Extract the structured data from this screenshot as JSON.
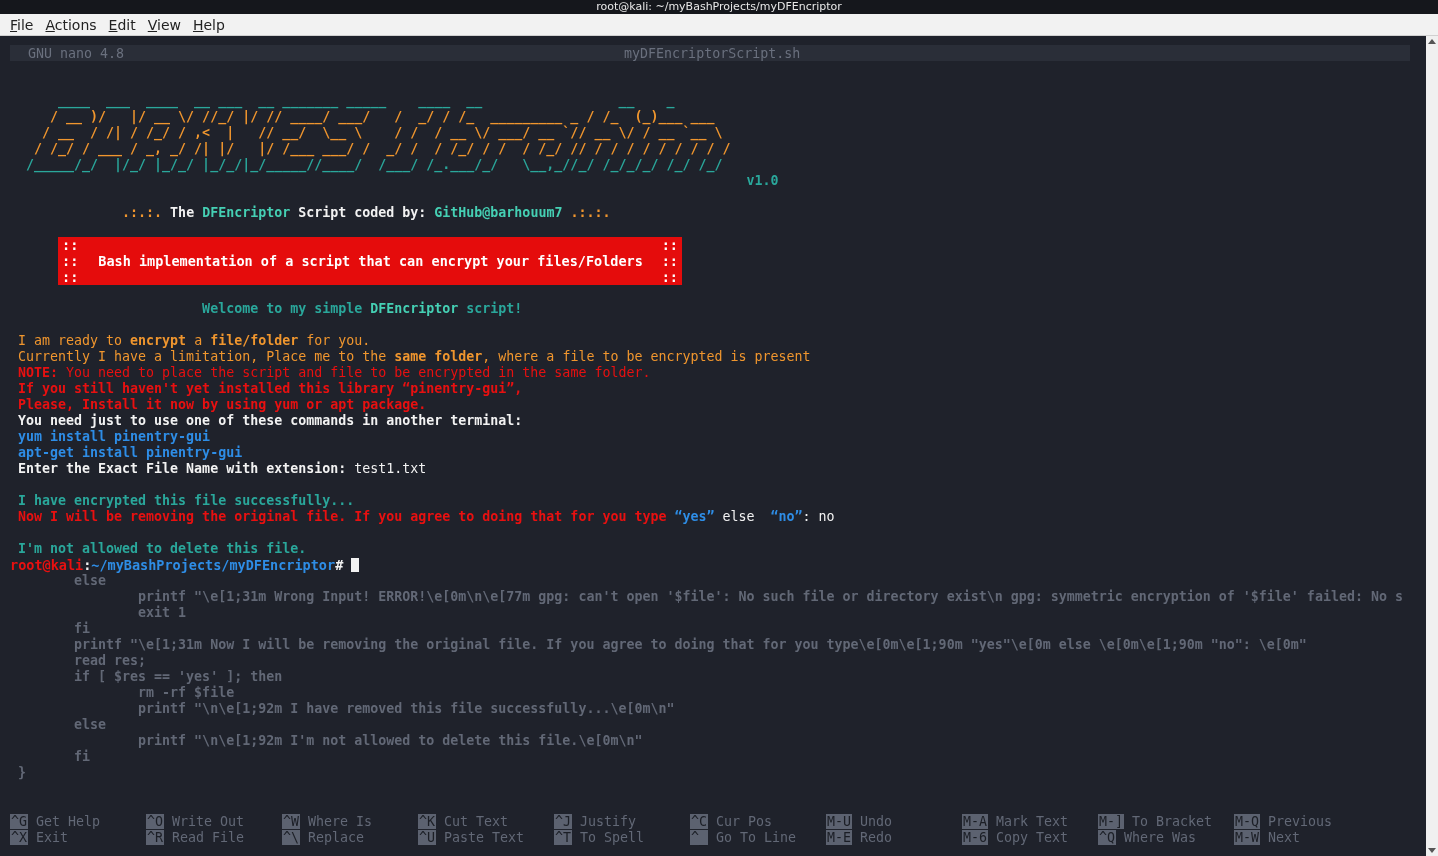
{
  "window": {
    "title": "root@kali: ~/myBashProjects/myDFEncriptor"
  },
  "menu": [
    {
      "label": "File"
    },
    {
      "label": "Actions"
    },
    {
      "label": "Edit"
    },
    {
      "label": "View"
    },
    {
      "label": "Help"
    }
  ],
  "editor_header": {
    "version": "GNU nano 4.8",
    "file": "myDFEncriptorScript.sh"
  },
  "terminal_lines": [
    {
      "kind": "art",
      "text": "     ____  ___  ____  __ ___  __ _______ _____    ____  __                 __    _        "
    },
    {
      "kind": "art",
      "text": "    / __ )/   |/ __ \\/ //_/ |/ // ____/ ___/   /  _/ / /_  _________ _ / /_  (_)___ ___ "
    },
    {
      "kind": "art",
      "text": "   / __  / /| / /_/ / ,<  |   // __/  \\__ \\    / /  / __ \\/ ___/ __ `// __ \\/ / __ `__ \\"
    },
    {
      "kind": "art",
      "text": "  / /_/ / ___ / _, _/ /| |/   |/ /___ ___/ /  _/ /  / /_/ / /  / /_/ // / / / / / / / / /"
    },
    {
      "kind": "art",
      "text": " /_____/_/  |/_/ |_/_/ |_/_/|_/_____//____/  /___/ /_.___/_/   \\__,_//_/ /_/_/_/ /_/ /_/ "
    },
    {
      "kind": "text",
      "segments": [
        {
          "text": "                                                                                           v1.0",
          "kind": "version"
        }
      ]
    },
    {
      "kind": "blank"
    },
    {
      "kind": "text",
      "segments": [
        {
          "text": "             .:.:.",
          "kind": "infostrong"
        },
        {
          "text": " The ",
          "kind": "strong"
        },
        {
          "text": "DFEncriptor",
          "kind": "name"
        },
        {
          "text": " Script coded by: ",
          "kind": "strong"
        },
        {
          "text": "GitHub@barhouum7",
          "kind": "name"
        },
        {
          "text": " .:.:.",
          "kind": "infostrong"
        }
      ]
    },
    {
      "kind": "blank"
    },
    {
      "kind": "box",
      "rows": [
        {
          "left": "::",
          "right": "::"
        },
        {
          "left": "::",
          "text": "Bash implementation of a script that can encrypt your files/Folders",
          "right": "::"
        },
        {
          "left": "::",
          "right": "::"
        }
      ]
    },
    {
      "kind": "blank"
    },
    {
      "kind": "text",
      "segments": [
        {
          "text": "                       Welcome to my simple ",
          "kind": "success"
        },
        {
          "text": "DFEncriptor",
          "kind": "name"
        },
        {
          "text": " script!",
          "kind": "success"
        }
      ]
    },
    {
      "kind": "blank"
    },
    {
      "kind": "text",
      "segments": [
        {
          "text": "I am ready to ",
          "kind": "info"
        },
        {
          "text": "encrypt",
          "kind": "infostrong"
        },
        {
          "text": " a ",
          "kind": "info"
        },
        {
          "text": "file/folder",
          "kind": "infostrong"
        },
        {
          "text": " for you.",
          "kind": "info"
        }
      ]
    },
    {
      "kind": "text",
      "segments": [
        {
          "text": "Currently I have a limitation, Place me to the ",
          "kind": "info"
        },
        {
          "text": "same folder",
          "kind": "infostrong"
        },
        {
          "text": ", where a file to be encrypted is present",
          "kind": "info"
        }
      ]
    },
    {
      "kind": "text",
      "segments": [
        {
          "text": "NOTE:",
          "kind": "alert"
        },
        {
          "text": " You need to place the script and file to be encrypted in the same folder.",
          "kind": "warning"
        }
      ]
    },
    {
      "kind": "text",
      "segments": [
        {
          "text": "If you still haven't yet installed this library “pinentry-gui”,",
          "kind": "alert"
        }
      ]
    },
    {
      "kind": "text",
      "segments": [
        {
          "text": "Please, Install it now by using yum or apt package.",
          "kind": "alert"
        }
      ]
    },
    {
      "kind": "text",
      "segments": [
        {
          "text": "You need just to use one of these commands in another terminal:",
          "kind": "strong"
        }
      ]
    },
    {
      "kind": "text",
      "segments": [
        {
          "text": "yum install pinentry-gui",
          "kind": "command"
        }
      ]
    },
    {
      "kind": "text",
      "segments": [
        {
          "text": "apt-get install pinentry-gui",
          "kind": "command"
        }
      ]
    },
    {
      "kind": "text",
      "segments": [
        {
          "text": "Enter the Exact File Name with extension: ",
          "kind": "strong"
        },
        {
          "text": "test1.txt",
          "kind": "plain"
        }
      ]
    },
    {
      "kind": "blank"
    },
    {
      "kind": "text",
      "segments": [
        {
          "text": "I have encrypted this file successfully...",
          "kind": "success"
        }
      ]
    },
    {
      "kind": "text",
      "segments": [
        {
          "text": "Now I will be removing the original file. If you agree to doing that for you type ",
          "kind": "alert"
        },
        {
          "text": "“yes”",
          "kind": "command"
        },
        {
          "text": " else  ",
          "kind": "plain"
        },
        {
          "text": "“no”",
          "kind": "command"
        },
        {
          "text": ": no",
          "kind": "plain"
        }
      ]
    },
    {
      "kind": "blank"
    },
    {
      "kind": "text",
      "segments": [
        {
          "text": "I'm not allowed to delete this file.",
          "kind": "success"
        }
      ]
    }
  ],
  "prompt": {
    "user": "root@kali",
    "separator": ":",
    "path": "~/myBashProjects/myDFEncriptor",
    "symbol": "# "
  },
  "source_lines": [
    "       else",
    "               printf \"\\e[1;31m Wrong Input! ERROR!\\e[0m\\n\\e[77m gpg: can't open '$file': No such file or directory exist\\n gpg: symmetric encryption of '$file' failed: No s",
    "               exit 1",
    "       fi",
    "       printf \"\\e[1;31m Now I will be removing the original file. If you agree to doing that for you type\\e[0m\\e[1;90m \"yes\"\\e[0m else \\e[0m\\e[1;90m \"no\": \\e[0m\"",
    "       read res;",
    "       if [ $res == 'yes' ]; then",
    "               rm -rf $file",
    "               printf \"\\n\\e[1;92m I have removed this file successfully...\\e[0m\\n\"",
    "       else",
    "               printf \"\\n\\e[1;92m I'm not allowed to delete this file.\\e[0m\\n\"",
    "       fi",
    "}"
  ],
  "shortcuts": [
    {
      "key": "^G",
      "label": "Get Help"
    },
    {
      "key": "^O",
      "label": "Write Out"
    },
    {
      "key": "^W",
      "label": "Where Is"
    },
    {
      "key": "^K",
      "label": "Cut Text"
    },
    {
      "key": "^J",
      "label": "Justify"
    },
    {
      "key": "^C",
      "label": "Cur Pos"
    },
    {
      "key": "M-U",
      "label": "Undo"
    },
    {
      "key": "M-A",
      "label": "Mark Text"
    },
    {
      "key": "M-]",
      "label": "To Bracket"
    },
    {
      "key": "M-Q",
      "label": "Previous"
    },
    {
      "key": "^X",
      "label": "Exit"
    },
    {
      "key": "^R",
      "label": "Read File"
    },
    {
      "key": "^\\",
      "label": "Replace"
    },
    {
      "key": "^U",
      "label": "Paste Text"
    },
    {
      "key": "^T",
      "label": "To Spell"
    },
    {
      "key": "^_",
      "label": "Go To Line"
    },
    {
      "key": "M-E",
      "label": "Redo"
    },
    {
      "key": "M-6",
      "label": "Copy Text"
    },
    {
      "key": "^Q",
      "label": "Where Was"
    },
    {
      "key": "M-W",
      "label": "Next"
    }
  ]
}
